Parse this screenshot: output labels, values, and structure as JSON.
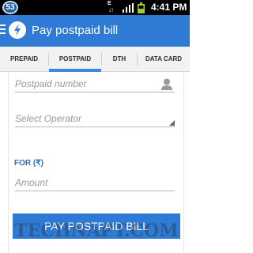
{
  "status_bar": {
    "notification_count": "53",
    "network_type": "E",
    "time": "4:41 PM"
  },
  "app_bar": {
    "title": "Pay postpaid bill"
  },
  "tabs": [
    {
      "label": "PREPAID",
      "active": false
    },
    {
      "label": "POSTPAID",
      "active": true
    },
    {
      "label": "DTH",
      "active": false
    },
    {
      "label": "DATA CARD",
      "active": false
    }
  ],
  "form": {
    "postpaid_number": {
      "placeholder": "Postpaid number",
      "value": ""
    },
    "operator_select": {
      "placeholder": "Select Operator"
    },
    "amount_section_label": "FOR (₹)",
    "amount": {
      "placeholder": "Amount",
      "value": ""
    },
    "pay_button_label": "PAY POSTPAID BILL"
  },
  "watermark": "TECHNAPT.COM",
  "colors": {
    "brand_blue": "#2f7ad4",
    "tab_indicator": "#3b8ae0",
    "section_label": "#2f6fb8",
    "status_bar": "#000000"
  },
  "icons": {
    "menu": "hamburger-icon",
    "logo": "app-logo-icon",
    "contact": "contact-person-icon",
    "dropdown": "dropdown-arrow-icon"
  }
}
